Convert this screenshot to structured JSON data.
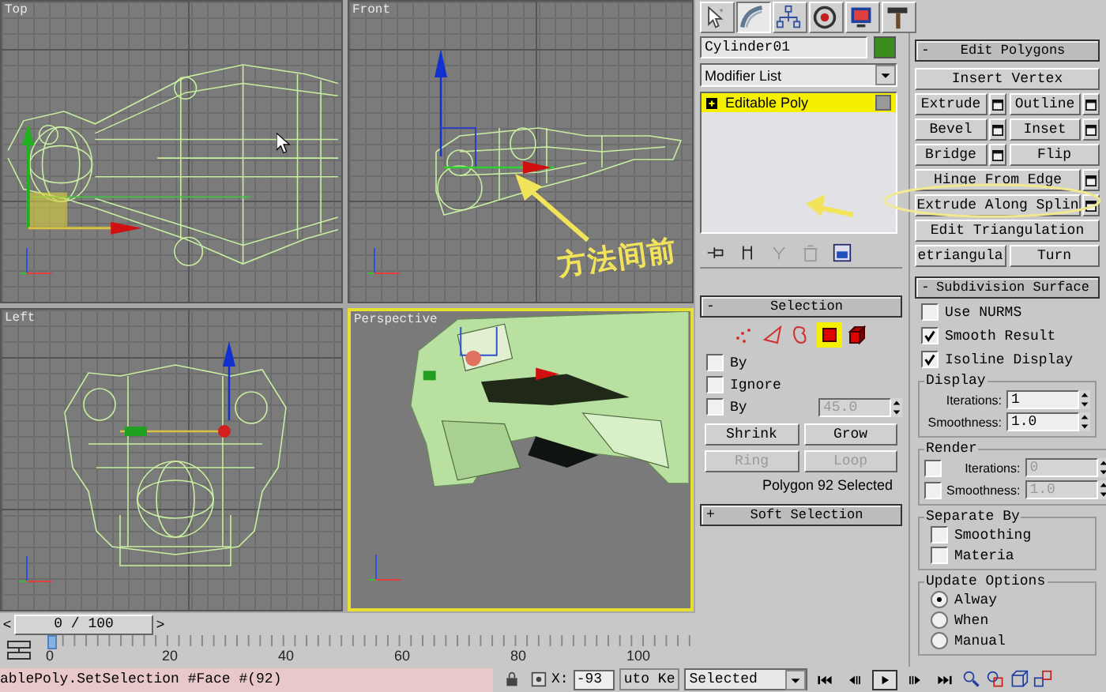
{
  "viewports": [
    {
      "label": "Top",
      "kind": "top",
      "active": false
    },
    {
      "label": "Front",
      "kind": "front",
      "active": false,
      "annotation": "方法间前"
    },
    {
      "label": "Left",
      "kind": "left",
      "active": false
    },
    {
      "label": "Perspective",
      "kind": "perspective",
      "active": true
    }
  ],
  "time_slider": {
    "prev": "<",
    "position": "0 / 100",
    "next": ">"
  },
  "timeline": {
    "ticks": [
      "0",
      "20",
      "40",
      "60",
      "80",
      "100"
    ]
  },
  "command_panel": {
    "tabs": [
      {
        "kind": "create",
        "selected": false
      },
      {
        "kind": "modify",
        "selected": true
      },
      {
        "kind": "hierarchy",
        "selected": false
      },
      {
        "kind": "motion",
        "selected": false
      },
      {
        "kind": "display",
        "selected": false
      },
      {
        "kind": "utilities",
        "selected": false
      }
    ],
    "object_name": "Cylinder01",
    "modifier_list": "Modifier List",
    "stack": [
      {
        "label": "Editable Poly",
        "selected": true
      }
    ],
    "stack_tools": [
      {
        "kind": "pin"
      },
      {
        "kind": "show-result"
      },
      {
        "kind": "make-unique"
      },
      {
        "kind": "remove"
      },
      {
        "kind": "configure"
      }
    ],
    "selection": {
      "toggle": "-",
      "title": "Selection",
      "levels": [
        {
          "kind": "vertex",
          "selected": false
        },
        {
          "kind": "edge",
          "selected": false
        },
        {
          "kind": "border",
          "selected": false
        },
        {
          "kind": "polygon",
          "selected": true
        },
        {
          "kind": "element",
          "selected": false
        }
      ],
      "options": [
        {
          "label": "By",
          "checked": false
        },
        {
          "label": "Ignore",
          "checked": false
        },
        {
          "label": "By",
          "checked": false,
          "value": "45.0"
        }
      ],
      "buttons": [
        {
          "label": "Shrink",
          "disabled": false
        },
        {
          "label": "Grow",
          "disabled": false
        },
        {
          "label": "Ring",
          "disabled": true
        },
        {
          "label": "Loop",
          "disabled": true
        }
      ],
      "status": "Polygon 92 Selected"
    },
    "soft_selection": {
      "toggle": "+",
      "title": "Soft Selection"
    },
    "edit_polygons": {
      "toggle": "-",
      "title": "Edit Polygons",
      "rows": [
        [
          {
            "label": "Insert Vertex",
            "settings": false
          }
        ],
        [
          {
            "label": "Extrude",
            "settings": true
          },
          {
            "label": "Outline",
            "settings": true
          }
        ],
        [
          {
            "label": "Bevel",
            "settings": true
          },
          {
            "label": "Inset",
            "settings": true
          }
        ],
        [
          {
            "label": "Bridge",
            "settings": true
          },
          {
            "label": "Flip",
            "settings": false
          }
        ],
        [
          {
            "label": "Hinge From Edge",
            "settings": true
          }
        ],
        [
          {
            "label": "Extrude Along Splin",
            "settings": true
          }
        ],
        [
          {
            "label": "Edit Triangulation",
            "settings": false
          }
        ],
        [
          {
            "label": "etriangula",
            "settings": false
          },
          {
            "label": "Turn",
            "settings": false
          }
        ]
      ]
    },
    "subdivision": {
      "toggle": "-",
      "title": "Subdivision Surface",
      "checks": [
        {
          "label": "Use NURMS",
          "checked": false
        },
        {
          "label": "Smooth Result",
          "checked": true
        },
        {
          "label": "Isoline Display",
          "checked": true
        }
      ],
      "display": {
        "title": "Display",
        "fields": [
          {
            "label": "Iterations:",
            "value": "1",
            "disabled": false
          },
          {
            "label": "Smoothness:",
            "value": "1.0",
            "disabled": false
          }
        ]
      },
      "render": {
        "title": "Render",
        "fields": [
          {
            "label": "Iterations:",
            "value": "0",
            "disabled": true,
            "checked": false
          },
          {
            "label": "Smoothness:",
            "value": "1.0",
            "disabled": true,
            "checked": false
          }
        ]
      },
      "separate_by": {
        "title": "Separate By",
        "checks": [
          {
            "label": "Smoothing",
            "checked": false
          },
          {
            "label": "Materia",
            "checked": false
          }
        ]
      },
      "update_options": {
        "title": "Update Options",
        "radios": [
          {
            "label": "Alway",
            "selected": true
          },
          {
            "label": "When",
            "selected": false
          },
          {
            "label": "Manual",
            "selected": false
          }
        ]
      }
    }
  },
  "status_bar": {
    "script_line": "ablePoly.SetSelection #Face #(92)",
    "x_label": "X:",
    "x_value": "-93",
    "auto_key": "uto Ke",
    "key_filter": "Selected",
    "playback": [
      {
        "kind": "start",
        "selected": false
      },
      {
        "kind": "prev",
        "selected": false
      },
      {
        "kind": "play",
        "selected": true
      },
      {
        "kind": "next",
        "selected": false
      },
      {
        "kind": "end",
        "selected": false
      }
    ],
    "nav": [
      {
        "kind": "zoom"
      },
      {
        "kind": "zoom-all"
      },
      {
        "kind": "zoom-extents"
      },
      {
        "kind": "zoom-extents-all"
      }
    ]
  }
}
